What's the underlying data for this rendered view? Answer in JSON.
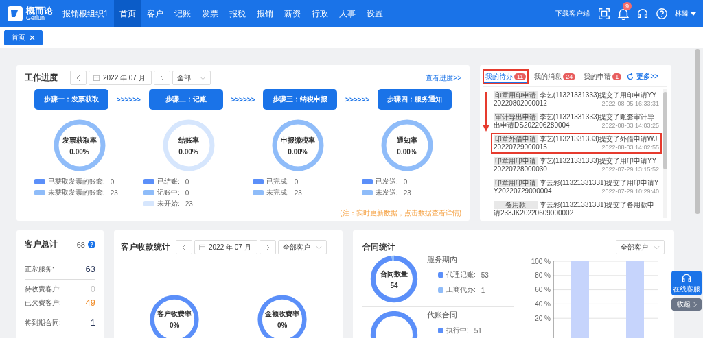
{
  "header": {
    "logo_name": "概而论",
    "logo_sub": "Gerlun",
    "org": "报销根组织1",
    "menu": [
      {
        "label": "首页",
        "selected": true
      },
      {
        "label": "客户",
        "selected": false
      },
      {
        "label": "记账",
        "selected": false
      },
      {
        "label": "发票",
        "selected": false
      },
      {
        "label": "报税",
        "selected": false
      },
      {
        "label": "报销",
        "selected": false
      },
      {
        "label": "薪资",
        "selected": false
      },
      {
        "label": "行政",
        "selected": false
      },
      {
        "label": "人事",
        "selected": false
      },
      {
        "label": "设置",
        "selected": false
      }
    ],
    "download": "下载客户端",
    "notifications": "9",
    "user": "林臻"
  },
  "page_tabs": [
    {
      "label": "首页",
      "selected": true
    }
  ],
  "work_progress": {
    "title": "工作进度",
    "month": "2022 年 07 月",
    "filter": "全部",
    "link": "查看进度>>",
    "steps": [
      {
        "label": "步骤一：发票获取",
        "connector": ">>>>>>"
      },
      {
        "label": "步骤二：记账",
        "connector": ">>>>>>"
      },
      {
        "label": "步骤三：纳税申报",
        "connector": ">>>>>>"
      },
      {
        "label": "步骤四：服务通知"
      }
    ],
    "charts": [
      {
        "title": "发票获取率",
        "value": "0.00%",
        "legend": [
          {
            "label": "已获取发票的账套:",
            "value": "0",
            "color": "#5b8ff9"
          },
          {
            "label": "未获取发票的账套:",
            "value": "23",
            "color": "#8fbcf9"
          }
        ]
      },
      {
        "title": "结账率",
        "value": "0.00%",
        "legend": [
          {
            "label": "已结账:",
            "value": "0",
            "color": "#5b8ff9"
          },
          {
            "label": "记账中:",
            "value": "0",
            "color": "#8fbcf9"
          },
          {
            "label": "未开始:",
            "value": "23",
            "color": "#d6e6fd"
          }
        ]
      },
      {
        "title": "申报缴税率",
        "value": "0.00%",
        "legend": [
          {
            "label": "已完成:",
            "value": "0",
            "color": "#5b8ff9"
          },
          {
            "label": "未完成:",
            "value": "23",
            "color": "#8fbcf9"
          }
        ]
      },
      {
        "title": "通知率",
        "value": "0.00%",
        "legend": [
          {
            "label": "已发送:",
            "value": "0",
            "color": "#5b8ff9"
          },
          {
            "label": "未发送:",
            "value": "23",
            "color": "#8fbcf9"
          }
        ]
      }
    ],
    "note": "(注：实时更新数据，点击数据查看详情)"
  },
  "tasks": {
    "tabs": [
      {
        "label": "我的待办",
        "count": "11",
        "selected": true,
        "highlighted": true
      },
      {
        "label": "我的消息",
        "count": "24",
        "selected": false,
        "highlighted": false
      },
      {
        "label": "我的申请",
        "count": "1",
        "selected": false,
        "highlighted": false
      }
    ],
    "more": "更多>>",
    "items": [
      {
        "tag": "印章用印申请",
        "text": "李艺(11321331333)提交了用印申请YY20220802000012",
        "time": "2022-08-05 16:33:31",
        "highlighted": false
      },
      {
        "tag": "审计导出申请",
        "text": "李艺(11321331333)提交了账套审计导出申请DS202206280004",
        "time": "2022-08-03 14:03:25",
        "highlighted": false
      },
      {
        "tag": "印章外借申请",
        "text": "李艺(11321331333)提交了外借申请WJ20220729000015",
        "time": "2022-08-03 14:02:55",
        "highlighted": true
      },
      {
        "tag": "印章用印申请",
        "text": "李艺(11321331333)提交了用印申请YY20220728000030",
        "time": "2022-07-29 13:15:52",
        "highlighted": false
      },
      {
        "tag": "印章用印申请",
        "text": "李云彩(11321331331)提交了用印申请YY20220729000004",
        "time": "2022-07-29 10:29:40",
        "highlighted": false
      },
      {
        "tag": "备用款",
        "text": "李云彩(11321331331)提交了备用款申请233JK20220609000002",
        "highlighted": false
      }
    ]
  },
  "customers": {
    "title": "客户总计",
    "total": "68",
    "groups": [
      {
        "rows": [
          {
            "label": "正常服务:",
            "value": "63",
            "color": "#2d3a5c"
          }
        ]
      },
      {
        "rows": [
          {
            "label": "待收费客户:",
            "value": "0",
            "color": "#bbbbbb"
          },
          {
            "label": "已欠费客户:",
            "value": "49",
            "color": "#f08a24"
          }
        ]
      },
      {
        "rows": [
          {
            "label": "将到期合同:",
            "value": "1",
            "color": "#2d3a5c"
          }
        ]
      }
    ]
  },
  "receivables": {
    "title": "客户收款统计",
    "month": "2022 年 07 月",
    "filter": "全部客户",
    "charts": [
      {
        "title": "客户收费率",
        "value": "0%"
      },
      {
        "title": "金额收费率",
        "value": "0%"
      }
    ]
  },
  "contracts": {
    "title": "合同统计",
    "filter": "全部客户",
    "groups": [
      {
        "title": "服务期内",
        "center_title": "合同数量",
        "center_value": "54",
        "legend": [
          {
            "label": "代理记账:",
            "value": "53",
            "color": "#5b8ff9"
          },
          {
            "label": "工商代办:",
            "value": "1",
            "color": "#8fbcf9"
          }
        ]
      },
      {
        "title": "代账合同",
        "legend": [
          {
            "label": "执行中:",
            "value": "51",
            "color": "#5b8ff9"
          }
        ]
      }
    ],
    "chart_data": {
      "type": "bar",
      "grid": true,
      "ylim": [
        0,
        100
      ],
      "yticks": [
        {
          "value": 20,
          "label": "20 %"
        },
        {
          "value": 40,
          "label": "40 %"
        },
        {
          "value": 60,
          "label": "60 %"
        },
        {
          "value": 80,
          "label": "80 %"
        },
        {
          "value": 100,
          "label": "100 %"
        }
      ],
      "values": [
        100,
        100
      ]
    }
  },
  "service": {
    "online": "在线客服",
    "collapse": "收起"
  }
}
